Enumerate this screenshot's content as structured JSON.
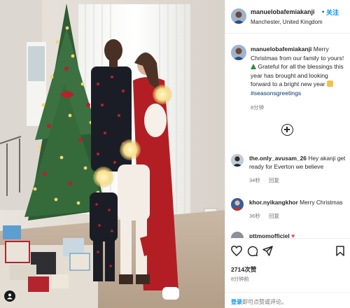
{
  "post": {
    "username": "manuelobafemiakanji",
    "separator": "•",
    "follow_label": "关注",
    "location": "Manchester, United Kingdom"
  },
  "caption": {
    "username": "manuelobafemiakanji",
    "line1": "Merry Christmas from our family to yours!",
    "line2": "Grateful for all the blessings this year has brought and looking forward to a bright new year",
    "hashtag": "#seasonsgreetings",
    "time": "8分钟"
  },
  "comments": [
    {
      "username": "the.only_avusam_26",
      "text": "Hey akanji get ready for Everton we believe",
      "time": "34秒",
      "reply_label": "回复"
    },
    {
      "username": "khor.nyikangkhor",
      "text": "Merry Christmas",
      "time": "36秒",
      "reply_label": "回复"
    },
    {
      "username": "pttmomofficiel",
      "text": "",
      "time": "",
      "reply_label": ""
    }
  ],
  "actions": {
    "like_icon": "heart-icon",
    "comment_icon": "comment-icon",
    "share_icon": "share-icon",
    "save_icon": "bookmark-icon"
  },
  "likes": "2714次赞",
  "post_time": "8分钟前",
  "login_prompt": {
    "link_label": "登录",
    "text": "即可点赞或评论。"
  },
  "icons": {
    "more_comments": "plus-circle-icon",
    "photo_badge": "user-tag-icon"
  },
  "colors": {
    "accent": "#0095f6",
    "hashtag": "#00376b",
    "heart": "#ed4956",
    "muted": "#737373"
  }
}
